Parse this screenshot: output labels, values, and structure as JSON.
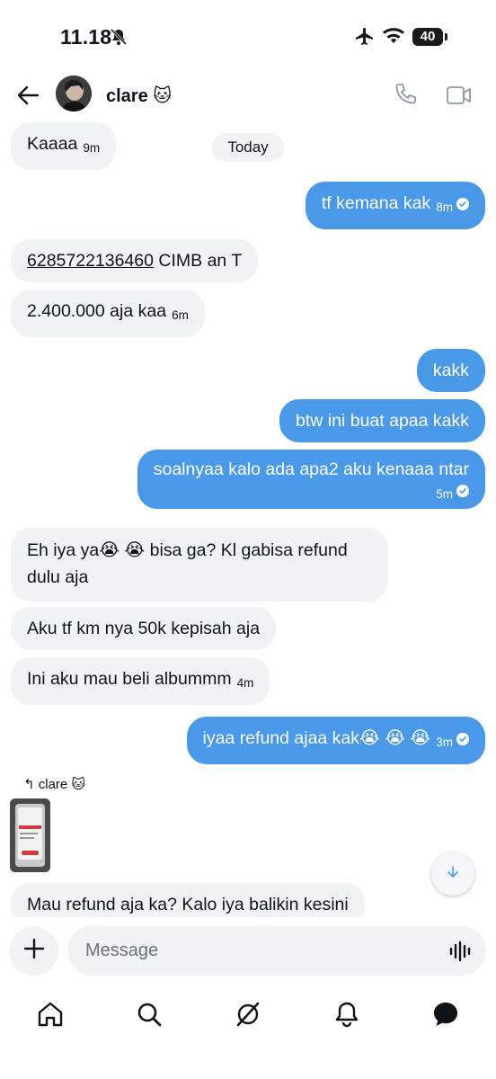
{
  "status": {
    "time": "11.18",
    "battery": "40"
  },
  "header": {
    "contact_name": "clare 🐱"
  },
  "chat": {
    "date_label": "Today",
    "messages": [
      {
        "text": "Kaaaa",
        "time": "9m"
      },
      {
        "text": "tf kemana kak",
        "time": "8m"
      },
      {
        "text_underlined": "6285722136460",
        "text": " CIMB an T"
      },
      {
        "text": "2.400.000 aja kaa",
        "time": "6m"
      },
      {
        "text": "kakk"
      },
      {
        "text": "btw ini buat apaa kakk"
      },
      {
        "text": "soalnyaa kalo ada apa2 aku kenaaa ntar",
        "time": "5m"
      },
      {
        "line1": "Eh iya ya😭 😭 bisa ga? Kl gabisa refund",
        "line2": "dulu aja"
      },
      {
        "text": "Aku tf km nya 50k kepisah aja"
      },
      {
        "text": "Ini aku mau beli albummm",
        "time": "4m"
      },
      {
        "text": "iyaa refund ajaa kak😭 😭 😭",
        "time": "3m"
      },
      {
        "text": "Mau refund aja ka? Kalo iya balikin kesini"
      }
    ],
    "reply_label": "clare 🐱"
  },
  "composer": {
    "placeholder": "Message"
  },
  "nav": {
    "items": [
      "home-icon",
      "search-icon",
      "grok-icon",
      "notifications-icon",
      "messages-icon"
    ]
  },
  "colors": {
    "accent": "#4a99e9",
    "incoming_bubble": "#eff3f4"
  }
}
